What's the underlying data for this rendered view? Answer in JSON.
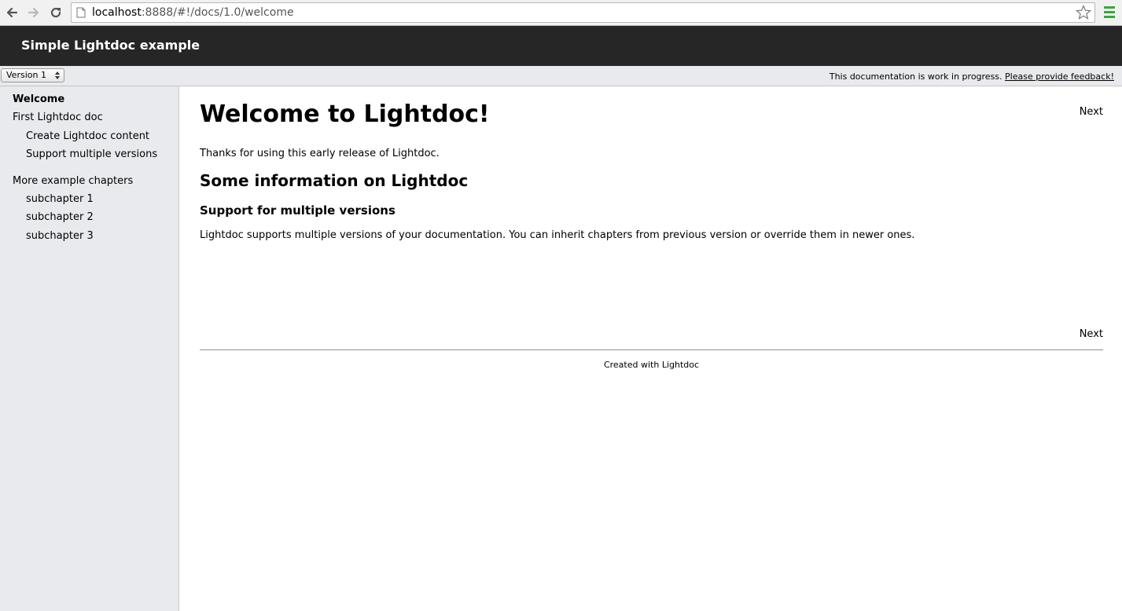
{
  "browser": {
    "url_host": "localhost",
    "url_path": ":8888/#!/docs/1.0/welcome"
  },
  "header": {
    "title": "Simple Lightdoc example"
  },
  "version_bar": {
    "selected_version": "Version 1",
    "notice": "This documentation is work in progress.",
    "feedback_link": "Please provide feedback!"
  },
  "sidebar": {
    "items": [
      {
        "label": "Welcome"
      },
      {
        "label": "First Lightdoc doc"
      },
      {
        "label": "Create Lightdoc content"
      },
      {
        "label": "Support multiple versions"
      },
      {
        "label": "More example chapters"
      },
      {
        "label": "subchapter 1"
      },
      {
        "label": "subchapter 2"
      },
      {
        "label": "subchapter 3"
      }
    ]
  },
  "content": {
    "title": "Welcome to Lightdoc!",
    "next_label": "Next",
    "intro": "Thanks for using this early release of Lightdoc.",
    "section_heading": "Some information on Lightdoc",
    "subsection_heading": "Support for multiple versions",
    "body": "Lightdoc supports multiple versions of your documentation. You can inherit chapters from previous version or override them in newer ones.",
    "footer": "Created with Lightdoc"
  },
  "colors": {
    "header_bg": "#262626",
    "sidebar_bg": "#e8eaed",
    "menu_icon": "#3aa63a"
  }
}
